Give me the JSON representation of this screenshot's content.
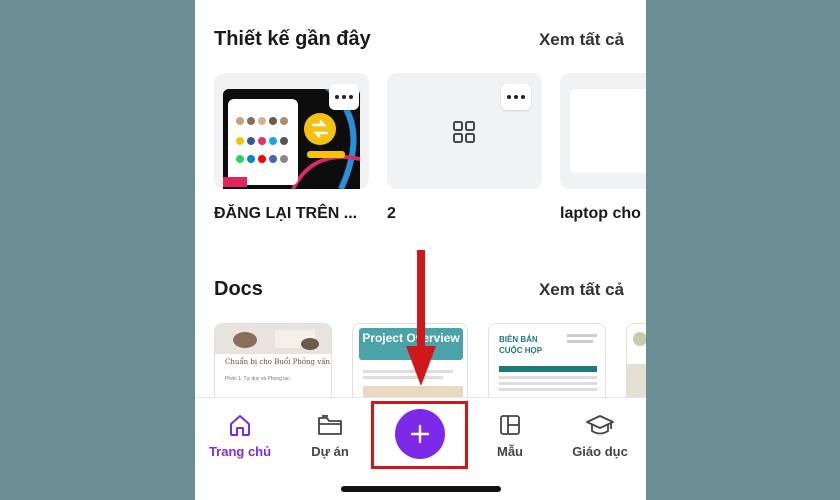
{
  "recent": {
    "title": "Thiết kế gần đây",
    "see_all": "Xem tất cả",
    "cards": [
      {
        "label": "ĐĂNG LẠI TRÊN ..."
      },
      {
        "label": "2"
      },
      {
        "label": "laptop cho"
      }
    ]
  },
  "docs": {
    "title": "Docs",
    "see_all": "Xem tất cả",
    "items": [
      {
        "heading": "Chuẩn bị cho Buổi Phỏng vấn",
        "sub": "Phần 1: Tự duy và Phong lạc"
      },
      {
        "heading": "Project Overview"
      },
      {
        "heading": "BIÊN BẢN CUỘC HỌP"
      }
    ]
  },
  "nav": {
    "items": [
      {
        "label": "Trang chủ",
        "icon": "home-icon"
      },
      {
        "label": "Dự án",
        "icon": "folder-icon"
      },
      {
        "label": "Mẫu",
        "icon": "template-icon"
      },
      {
        "label": "Giáo dục",
        "icon": "graduation-cap-icon"
      }
    ],
    "create_icon": "plus-icon"
  },
  "colors": {
    "accent": "#7d2ae8",
    "highlight": "#d0171b",
    "backdrop": "#6b8e95"
  }
}
